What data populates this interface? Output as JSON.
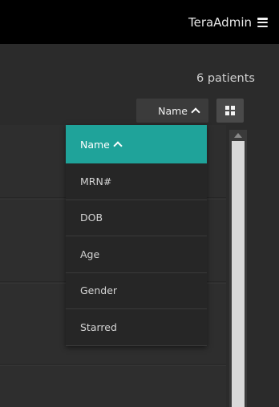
{
  "header": {
    "user_label": "TeraAdmin",
    "menu_icon": "hamburger-menu-icon"
  },
  "toolbar": {
    "patient_count": "6 patients",
    "sort_button_label": "Name",
    "sort_direction_icon": "chevron-up-icon",
    "view_toggle_icon": "grid-view-icon"
  },
  "sort_menu": {
    "items": [
      {
        "label": "Name",
        "selected": true
      },
      {
        "label": "MRN#",
        "selected": false
      },
      {
        "label": "DOB",
        "selected": false
      },
      {
        "label": "Age",
        "selected": false
      },
      {
        "label": "Gender",
        "selected": false
      },
      {
        "label": "Starred",
        "selected": false
      }
    ]
  },
  "colors": {
    "topbar_bg": "#000000",
    "page_bg": "#2b2b2b",
    "accent_selected": "#1fa39a"
  }
}
